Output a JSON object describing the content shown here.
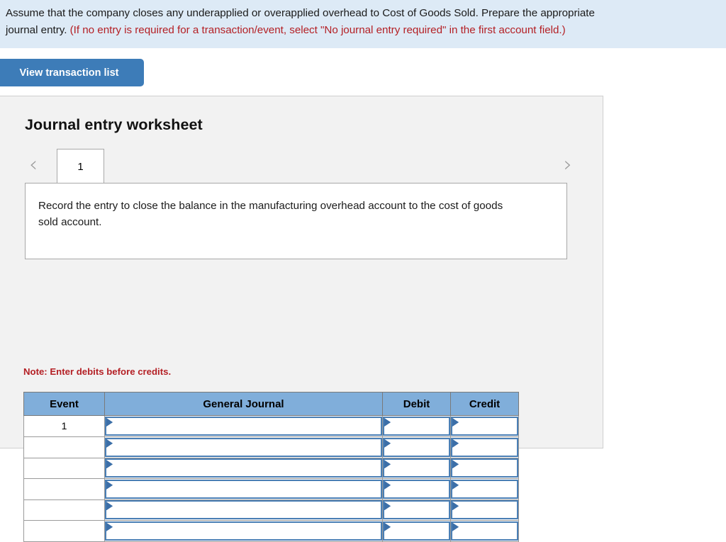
{
  "instruction": {
    "line1": "Assume that the company closes any underapplied or overapplied overhead to Cost of Goods Sold. Prepare the appropriate",
    "line2_plain": "journal entry. ",
    "line2_note": "(If no entry is required for a transaction/event, select \"No journal entry required\" in the first account field.)",
    "note_color": "#b42025",
    "banner_color": "#ddeaf6"
  },
  "toolbar": {
    "view_transaction_list_label": "View transaction list",
    "button_color": "#3d7cb8"
  },
  "worksheet": {
    "title": "Journal entry worksheet",
    "prev_arrow_icon": "‹",
    "next_arrow_icon": "›",
    "tabs": [
      {
        "label": "1",
        "active": true
      }
    ],
    "requirement_text": "Record the entry to close the balance in the manufacturing overhead account to the cost of goods sold account.",
    "debits_note": "Note: Enter debits before credits.",
    "panel_color": "#f2f2f2"
  },
  "journal_table": {
    "headers": [
      "Event",
      "General Journal",
      "Debit",
      "Credit"
    ],
    "header_color": "#80aeda",
    "input_border_color": "#4a7fb5",
    "rows": [
      {
        "event": "1",
        "general_journal": "",
        "debit": "",
        "credit": ""
      },
      {
        "event": "",
        "general_journal": "",
        "debit": "",
        "credit": ""
      },
      {
        "event": "",
        "general_journal": "",
        "debit": "",
        "credit": ""
      },
      {
        "event": "",
        "general_journal": "",
        "debit": "",
        "credit": ""
      },
      {
        "event": "",
        "general_journal": "",
        "debit": "",
        "credit": ""
      },
      {
        "event": "",
        "general_journal": "",
        "debit": "",
        "credit": ""
      }
    ]
  }
}
